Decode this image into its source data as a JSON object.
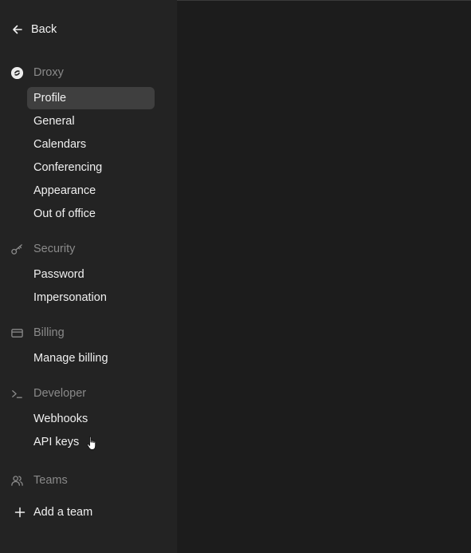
{
  "nav": {
    "back_label": "Back",
    "sections": [
      {
        "title": "Droxy",
        "icon": "brand-icon",
        "items": [
          "Profile",
          "General",
          "Calendars",
          "Conferencing",
          "Appearance",
          "Out of office"
        ]
      },
      {
        "title": "Security",
        "icon": "key-icon",
        "items": [
          "Password",
          "Impersonation"
        ]
      },
      {
        "title": "Billing",
        "icon": "credit-card-icon",
        "items": [
          "Manage billing"
        ]
      },
      {
        "title": "Developer",
        "icon": "terminal-icon",
        "items": [
          "Webhooks",
          "API keys"
        ]
      },
      {
        "title": "Teams",
        "icon": "users-icon",
        "items": []
      }
    ],
    "active_item": "Profile",
    "add_team_label": "Add a team"
  },
  "colors": {
    "sidebar_bg": "#232323",
    "main_bg": "#1c1c1c",
    "active_bg": "#3f3f3f",
    "text": "#f0f0f0",
    "muted": "#8a8a8a"
  }
}
